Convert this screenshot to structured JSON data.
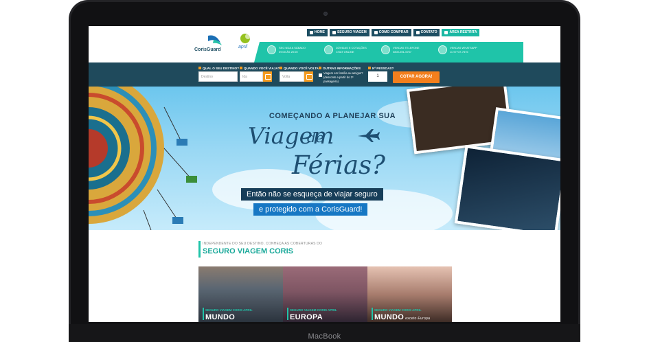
{
  "device": {
    "brand": "MacBook"
  },
  "header": {
    "logo_coris": "CorisGuard",
    "logo_april": "april",
    "nav": [
      {
        "label": "HOME",
        "icon": "home-icon"
      },
      {
        "label": "SEGURO VIAGEM",
        "icon": "plane-icon"
      },
      {
        "label": "COMO COMPRAR",
        "icon": "cart-icon"
      },
      {
        "label": "CONTATO",
        "icon": "mail-icon"
      },
      {
        "label": "ÁREA RESTRITA",
        "icon": "lock-icon"
      }
    ],
    "contacts": [
      {
        "line1": "SEG NDA A SÁBADO",
        "line2": "09:00 ÀS 20:00",
        "icon": "clock-icon"
      },
      {
        "line1": "DÚVIDAS E COTAÇÕES",
        "line2": "CHAT ONLINE",
        "icon": "chat-icon"
      },
      {
        "line1": "VENDAS TELEFONE",
        "line2": "0800-591-5757",
        "icon": "phone-icon"
      },
      {
        "line1": "VENDAS WHATSAPP",
        "line2": "11 97737-7576",
        "icon": "whatsapp-icon"
      }
    ]
  },
  "search": {
    "destino_label": "QUAL O SEU DESTINO?",
    "destino_placeholder": "Destino",
    "ida_label": "QUANDO VOCÊ VIAJA?",
    "ida_placeholder": "Ida",
    "volta_label": "QUANDO VOCÊ VOLTA?",
    "volta_placeholder": "Volta",
    "info_label": "OUTRAS INFORMAÇÕES",
    "info_text": "Viagem em família ou amigos? (desconto a partir do 2º passageiro)",
    "pessoas_label": "Nº PESSOAS?",
    "pessoas_value": "1",
    "cta": "COTAR AGORA!"
  },
  "banner": {
    "line1": "COMEÇANDO A PLANEJAR SUA",
    "viagem": "Viagem",
    "de": "de",
    "ferias": "Férias?",
    "tag1": "Então não se esqueça de viajar seguro",
    "tag2": "e protegido com a CorisGuard!"
  },
  "section": {
    "subtitle": "INDEPENDENTE DO SEU DESTINO, CONHEÇA AS COBERTURAS DO",
    "title": "SEGURO VIAGEM CORIS",
    "cards": [
      {
        "caption": "SEGURO VIAGEM CORIS APRIL",
        "title": "MUNDO",
        "extra": ""
      },
      {
        "caption": "SEGURO VIAGEM CORIS APRIL",
        "title": "EUROPA",
        "extra": ""
      },
      {
        "caption": "SEGURO VIAGEM CORIS APRIL",
        "title": "MUNDO",
        "extra": "exceto Europa"
      }
    ]
  }
}
